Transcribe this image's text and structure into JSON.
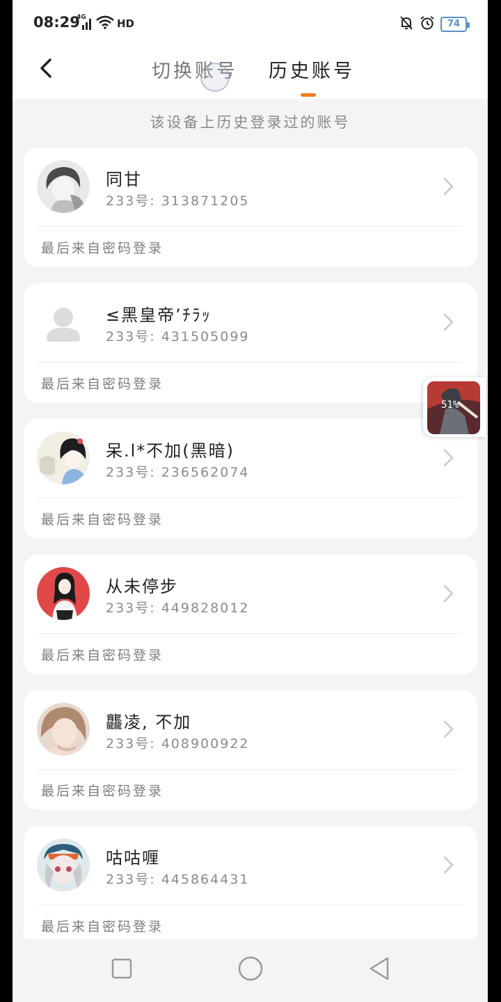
{
  "status_bar": {
    "time": "08:29",
    "network": "4G",
    "hd": "HD",
    "battery": "74"
  },
  "header": {
    "tabs": [
      {
        "label": "切换账号",
        "active": false
      },
      {
        "label": "历史账号",
        "active": true
      }
    ],
    "accent_color": "#f07a20"
  },
  "subtitle": "该设备上历史登录过的账号",
  "accounts": [
    {
      "name": "同甘",
      "uid": "233号: 313871205",
      "login_method": "最后来自密码登录",
      "avatar": "avatar-sketch-boy"
    },
    {
      "name": "≤黑皇帝’ﾁﾗｯ",
      "uid": "233号: 431505099",
      "login_method": "最后来自密码登录",
      "avatar": "avatar-default-person"
    },
    {
      "name": "呆.l*不加(黑暗)",
      "uid": "233号: 236562074",
      "login_method": "最后来自密码登录",
      "avatar": "avatar-anime-couple"
    },
    {
      "name": "从未停步",
      "uid": "233号: 449828012",
      "login_method": "最后来自密码登录",
      "avatar": "avatar-red-girl"
    },
    {
      "name": "龘凌, 不加",
      "uid": "233号: 408900922",
      "login_method": "最后来自密码登录",
      "avatar": "avatar-doll"
    },
    {
      "name": "咕咕喱",
      "uid": "233号: 445864431",
      "login_method": "最后来自密码登录",
      "avatar": "avatar-chibi-girl"
    }
  ],
  "float_widget": {
    "percent": "51%"
  }
}
